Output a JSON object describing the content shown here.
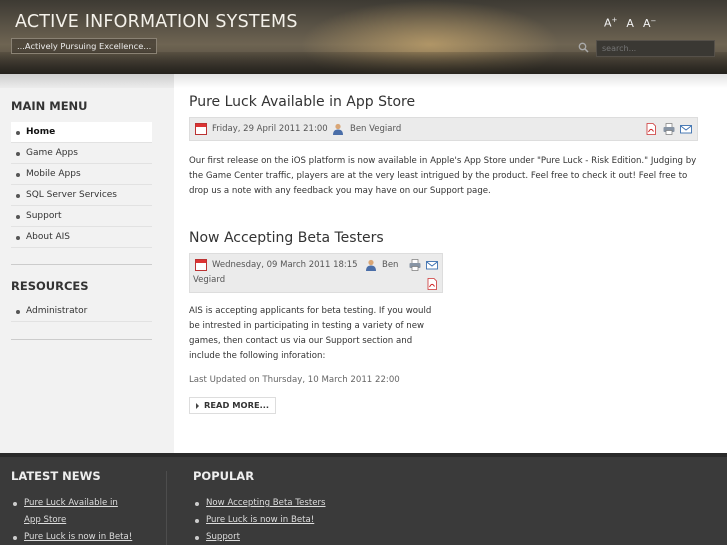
{
  "header": {
    "site_title": "ACTIVE INFORMATION SYSTEMS",
    "tagline": "...Actively Pursuing Excellence...",
    "font_controls": {
      "increase": "A",
      "increase_sup": "+",
      "reset": "A",
      "decrease": "A",
      "decrease_sup": "−"
    },
    "search_placeholder": "search..."
  },
  "sidebar": {
    "main_menu_title": "MAIN MENU",
    "main_menu": [
      {
        "label": "Home",
        "active": true
      },
      {
        "label": "Game Apps"
      },
      {
        "label": "Mobile Apps"
      },
      {
        "label": "SQL Server Services"
      },
      {
        "label": "Support"
      },
      {
        "label": "About AIS"
      }
    ],
    "resources_title": "RESOURCES",
    "resources": [
      {
        "label": "Administrator"
      }
    ]
  },
  "articles": [
    {
      "title": "Pure Luck Available in App Store",
      "date": "Friday, 29 April 2011 21:00",
      "author": "Ben Vegiard",
      "text": "Our first release on the iOS platform is now available in Apple's App Store under \"Pure Luck - Risk Edition.\"  Judging by the Game Center traffic, players are at the very least intrigued by the product.  Feel free to check it out!  Feel free to drop us a note with any feedback you may have on our Support page."
    },
    {
      "title": "Now Accepting Beta Testers",
      "date": "Wednesday, 09 March 2011 18:15",
      "author_line1": "Ben",
      "author_line2": "Vegiard",
      "text": "AIS is accepting applicants for beta testing.  If you would be intrested in participating in testing a variety of new games, then contact us via our Support section and include the following inforation:",
      "updated": "Last Updated on Thursday, 10 March 2011 22:00",
      "read_more": "READ MORE..."
    }
  ],
  "footer": {
    "latest_title": "LATEST NEWS",
    "latest": [
      {
        "label_line1": "Pure Luck Available in",
        "label_line2": "App Store"
      },
      {
        "label_line1": "Pure Luck is now in Beta!"
      }
    ],
    "popular_title": "POPULAR",
    "popular": [
      {
        "label": "Now Accepting Beta Testers"
      },
      {
        "label": "Pure Luck is now in Beta!"
      },
      {
        "label": "Support"
      }
    ]
  },
  "colors": {
    "header_dark": "#3d3a33",
    "sidebar_bg": "#f2f2f2",
    "footer_bg": "#3a3a3a",
    "pdf_red": "#cc2222",
    "mail_blue": "#3a6fb0"
  }
}
